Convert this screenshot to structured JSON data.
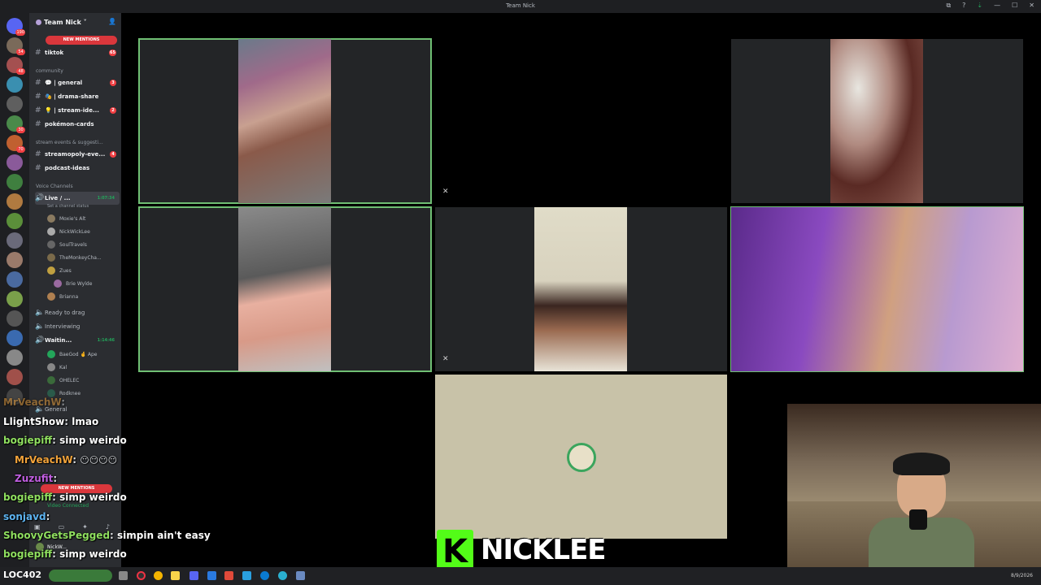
{
  "window": {
    "title": "Team Nick",
    "controls": [
      "⧉",
      "?",
      "⇣",
      "—",
      "☐",
      "✕"
    ]
  },
  "server": {
    "name": "Team Nick",
    "new_mentions_label": "NEW MENTIONS"
  },
  "guild_badges": [
    "190",
    "54",
    "48",
    "30",
    "70"
  ],
  "channels": [
    {
      "name": "tiktok",
      "badge": "65"
    },
    {
      "category": "community"
    },
    {
      "name": "💬 | general",
      "badge": "3"
    },
    {
      "name": "🎭 | drama-share",
      "badge": ""
    },
    {
      "name": "💡 | stream-ide...",
      "badge": "2"
    },
    {
      "name": "pokémon-cards",
      "badge": ""
    },
    {
      "category": "stream events & suggesti..."
    },
    {
      "name": "streamopoly-eve...",
      "badge": "4"
    },
    {
      "name": "podcast-ideas",
      "badge": ""
    }
  ],
  "voice": {
    "category": "Voice Channels",
    "live_channel": "Live / ...",
    "live_timer": "1:07:34",
    "status_hint": "Set a channel status",
    "members": [
      "Moxie's Alt",
      "NickWickLee",
      "SoulTravels",
      "TheMonkeyCha...",
      "Zues",
      "Brie Wylde",
      "Brianna"
    ],
    "ready": "Ready to drag",
    "interviewing": "Interviewing",
    "waiting": "Waitin...",
    "waiting_timer": "1:14:46",
    "waiting_members": [
      "BaeGod 🤞 Ape",
      "Kal",
      "OHELEC",
      "Rodknee"
    ],
    "general": "General"
  },
  "bottom": {
    "new_mentions": "NEW MENTIONS",
    "video_connected": "Video Connected",
    "user": "NickW..."
  },
  "chat": [
    {
      "user": "MrVeachW",
      "text": "",
      "color": "#f2a33a"
    },
    {
      "user": "LlightShow",
      "text": "lmao",
      "color": "#ffffff"
    },
    {
      "user": "bogiepiff",
      "text": "simp weirdo",
      "color": "#8fdf5f"
    },
    {
      "user": "MrVeachW",
      "text": "",
      "color": "#f2a33a"
    },
    {
      "user": "Zuzufit",
      "text": "",
      "color": "#c05ee0"
    },
    {
      "user": "bogiepiff",
      "text": "simp weirdo",
      "color": "#8fdf5f"
    },
    {
      "user": "sonjavd",
      "text": "",
      "color": "#5db3f0"
    },
    {
      "user": "ShoovyGetsPegged",
      "text": "simpin ain't easy",
      "color": "#8fdf5f"
    },
    {
      "user": "bogiepiff",
      "text": "simp weirdo",
      "color": "#8fdf5f"
    }
  ],
  "overlay": {
    "brand": "NICKLEE",
    "logo_letter": "K",
    "brand_color": "#53fc18"
  },
  "taskbar": {
    "left_text": "LOC402",
    "date": "8/9/2026"
  }
}
